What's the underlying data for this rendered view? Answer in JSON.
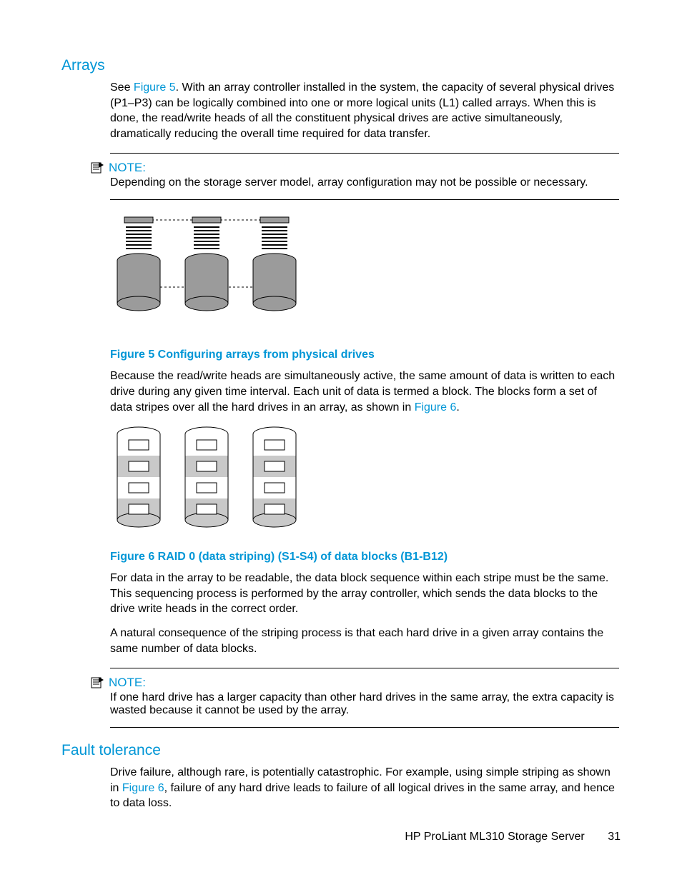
{
  "sections": {
    "arrays_title": "Arrays",
    "fault_title": "Fault tolerance"
  },
  "paragraphs": {
    "arrays_intro_a": "See ",
    "arrays_intro_link": "Figure 5",
    "arrays_intro_b": ".  With an array controller installed in the system, the capacity of several physical drives (P1–P3) can be logically combined into one or more logical units (L1) called arrays.  When this is done, the read/write heads of all the constituent physical drives are active simultaneously, dramatically reducing the overall time required for data transfer.",
    "fig5_after_a": "Because the read/write heads are simultaneously active, the same amount of data is written to each drive during any given time interval.  Each unit of data is termed a block.  The blocks form a set of data stripes over all the hard drives in an array, as shown in ",
    "fig5_after_link": "Figure 6",
    "fig5_after_b": ".",
    "fig6_after_1": "For data in the array to be readable, the data block sequence within each stripe must be the same. This sequencing process is performed by the array controller, which sends the data blocks to the drive write heads in the correct order.",
    "fig6_after_2": "A natural consequence of the striping process is that each hard drive in a given array contains the same number of data blocks.",
    "fault_intro_a": "Drive failure, although rare, is potentially catastrophic.  For example, using simple striping as shown in ",
    "fault_intro_link": "Figure 6",
    "fault_intro_b": ", failure of any hard drive leads to failure of all logical drives in the same array, and hence to data loss."
  },
  "notes": {
    "label": "NOTE:",
    "note1": "Depending on the storage server model, array configuration may not be possible or necessary.",
    "note2": "If one hard drive has a larger capacity than other hard drives in the same array, the extra capacity is wasted because it cannot be used by the array."
  },
  "figures": {
    "fig5_caption": "Figure 5 Configuring arrays from physical drives",
    "fig6_caption": "Figure 6 RAID 0 (data striping) (S1-S4) of data blocks (B1-B12)"
  },
  "footer": {
    "product": "HP ProLiant ML310 Storage Server",
    "page": "31"
  }
}
